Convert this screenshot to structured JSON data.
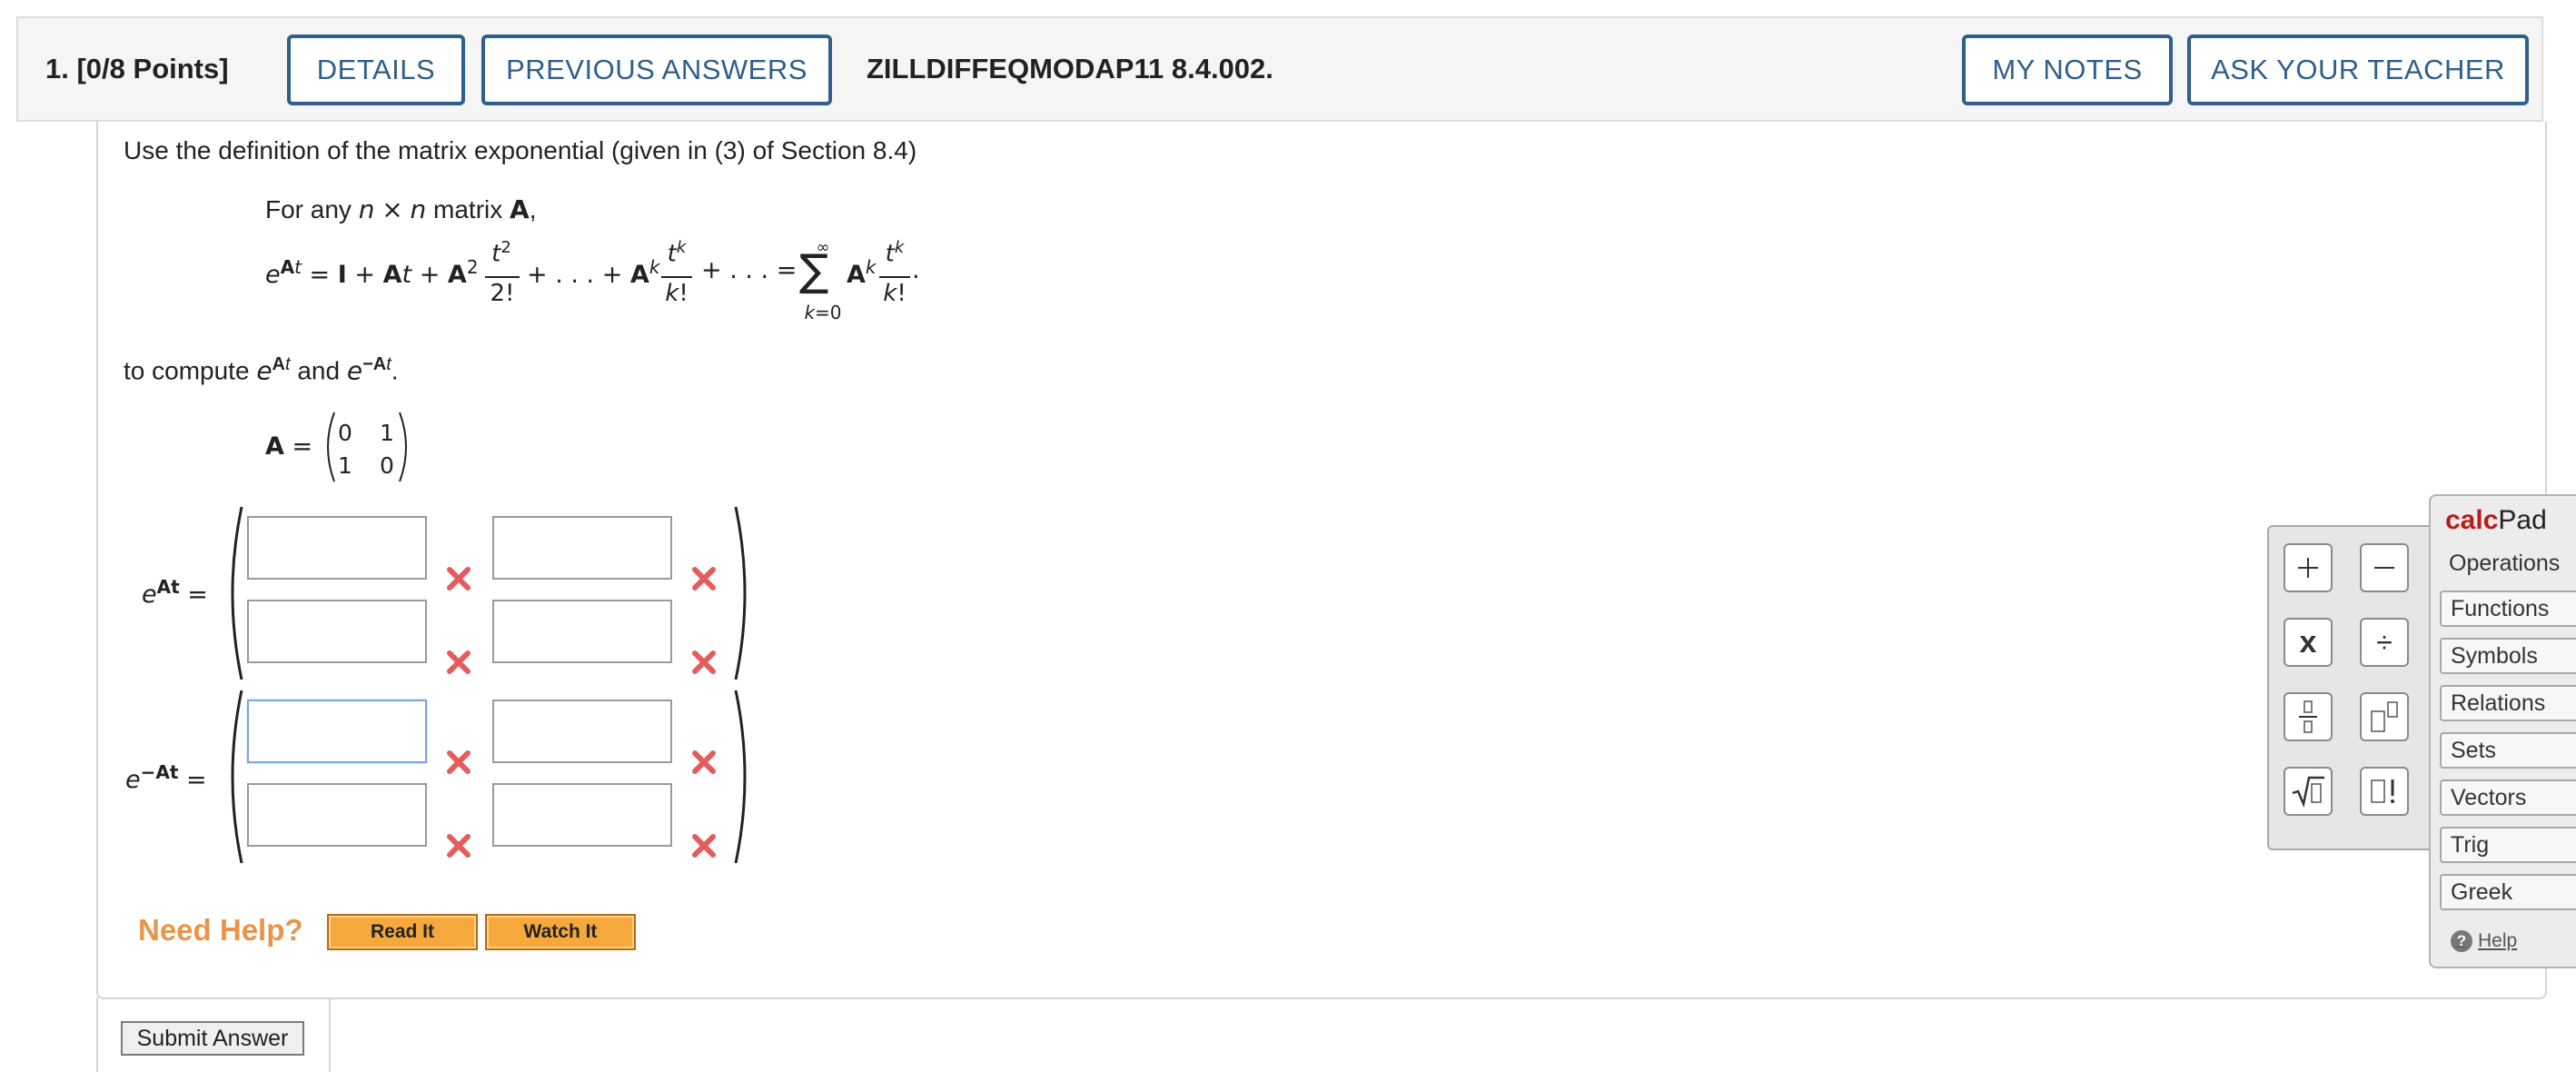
{
  "header": {
    "question_number": "1.",
    "points": "[0/8 Points]",
    "details_label": "DETAILS",
    "previous_answers_label": "PREVIOUS ANSWERS",
    "question_id": "ZILLDIFFEQMODAP11 8.4.002.",
    "my_notes_label": "MY NOTES",
    "ask_teacher_label": "ASK YOUR TEACHER"
  },
  "prompt": {
    "intro": "Use the definition of the matrix exponential (given in (3) of Section 8.4)",
    "definition_lead": "For any",
    "definition_n": "n",
    "definition_times": "×",
    "definition_matrix": "matrix",
    "definition_A": "A",
    "to_compute": "to compute",
    "and": "and"
  },
  "matrix_A": {
    "rows": [
      [
        "0",
        "1"
      ],
      [
        "1",
        "0"
      ]
    ]
  },
  "answers": {
    "eAt": {
      "label": "e",
      "superscript": "At",
      "cells": [
        "",
        "",
        "",
        ""
      ],
      "status": [
        "incorrect",
        "incorrect",
        "incorrect",
        "incorrect"
      ]
    },
    "e_negAt": {
      "label": "e",
      "superscript": "−At",
      "cells": [
        "",
        "",
        "",
        ""
      ],
      "status": [
        "incorrect",
        "incorrect",
        "incorrect",
        "incorrect"
      ]
    }
  },
  "help": {
    "need_help_label": "Need Help?",
    "read_it_label": "Read It",
    "watch_it_label": "Watch It"
  },
  "submit_label": "Submit Answer",
  "calcpad": {
    "title_calc": "calc",
    "title_pad": "Pad",
    "tabs": [
      "Operations",
      "Functions",
      "Symbols",
      "Relations",
      "Sets",
      "Vectors",
      "Trig",
      "Greek"
    ],
    "active_tab": "Operations",
    "help_label": "Help",
    "operation_buttons": [
      "plus",
      "minus",
      "times",
      "divide",
      "fraction",
      "exponent",
      "square-root",
      "factorial"
    ]
  },
  "colors": {
    "button_border": "#2f5f8a",
    "need_help": "#e8954a",
    "help_button": "#f5a83c",
    "incorrect_x": "#e35d5d",
    "calcpad_brand": "#b71c1c"
  }
}
